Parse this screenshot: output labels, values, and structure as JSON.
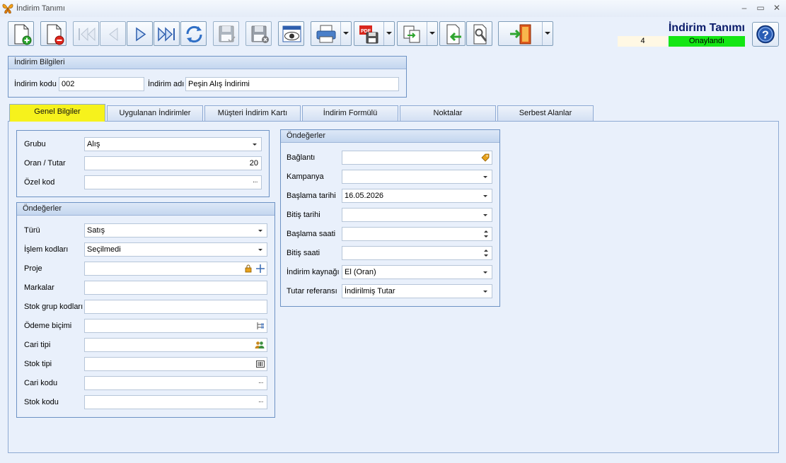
{
  "window": {
    "title": "İndirim Tanımı",
    "minimize": "–",
    "maximize": "▭",
    "close": "✕"
  },
  "header": {
    "title": "İndirim Tanımı",
    "record_number": "4",
    "status": "Onaylandı",
    "status_color": "#14e614"
  },
  "toolbar": {
    "buttons": [
      {
        "name": "new-record-button",
        "icon": "new-document-icon"
      },
      {
        "name": "delete-record-button",
        "icon": "delete-document-icon"
      },
      {
        "name": "first-record-button",
        "icon": "first-icon"
      },
      {
        "name": "previous-record-button",
        "icon": "previous-icon"
      },
      {
        "name": "next-record-button",
        "icon": "next-icon"
      },
      {
        "name": "last-record-button",
        "icon": "last-icon"
      },
      {
        "name": "refresh-button",
        "icon": "refresh-icon"
      },
      {
        "name": "save-button",
        "icon": "save-icon"
      },
      {
        "name": "save-cancel-button",
        "icon": "save-cancel-icon"
      },
      {
        "name": "preview-button",
        "icon": "eye-icon"
      },
      {
        "name": "print-button",
        "icon": "printer-icon"
      },
      {
        "name": "export-pdf-button",
        "icon": "pdf-icon"
      },
      {
        "name": "copy-button",
        "icon": "copy-icon"
      },
      {
        "name": "import-button",
        "icon": "import-icon"
      },
      {
        "name": "tools-button",
        "icon": "tools-icon"
      },
      {
        "name": "exit-button",
        "icon": "exit-door-icon"
      },
      {
        "name": "help-button",
        "icon": "help-icon"
      }
    ]
  },
  "indirim_bilgileri": {
    "title": "İndirim Bilgileri",
    "kod_label": "İndirim kodu",
    "kod_value": "002",
    "ad_label": "İndirim adı",
    "ad_value": "Peşin Alış İndirimi"
  },
  "tabs": [
    {
      "label": "Genel Bilgiler",
      "active": true
    },
    {
      "label": "Uygulanan İndirimler",
      "active": false
    },
    {
      "label": "Müşteri İndirim Kartı",
      "active": false
    },
    {
      "label": "İndirim Formülü",
      "active": false
    },
    {
      "label": "Noktalar",
      "active": false
    },
    {
      "label": "Serbest Alanlar",
      "active": false
    }
  ],
  "genel": {
    "grubu_label": "Grubu",
    "grubu_value": "Alış",
    "oran_label": "Oran / Tutar",
    "oran_value": "20",
    "ozel_kod_label": "Özel kod",
    "ozel_kod_value": ""
  },
  "ondegerler_left": {
    "title": "Öndeğerler",
    "turu_label": "Türü",
    "turu_value": "Satış",
    "islem_label": "İşlem kodları",
    "islem_value": "Seçilmedi",
    "proje_label": "Proje",
    "markalar_label": "Markalar",
    "stok_grup_label": "Stok grup kodları",
    "odeme_label": "Ödeme biçimi",
    "cari_tipi_label": "Cari tipi",
    "stok_tipi_label": "Stok tipi",
    "cari_kodu_label": "Cari kodu",
    "stok_kodu_label": "Stok kodu"
  },
  "ondegerler_right": {
    "title": "Öndeğerler",
    "baglanti_label": "Bağlantı",
    "kampanya_label": "Kampanya",
    "baslama_tarihi_label": "Başlama tarihi",
    "baslama_tarihi_value": "16.05.2026",
    "bitis_tarihi_label": "Bitiş tarihi",
    "baslama_saati_label": "Başlama saati",
    "bitis_saati_label": "Bitiş saati",
    "kaynak_label": "İndirim kaynağı",
    "kaynak_value": "El (Oran)",
    "tutar_ref_label": "Tutar referansı",
    "tutar_ref_value": "İndirilmiş Tutar"
  }
}
